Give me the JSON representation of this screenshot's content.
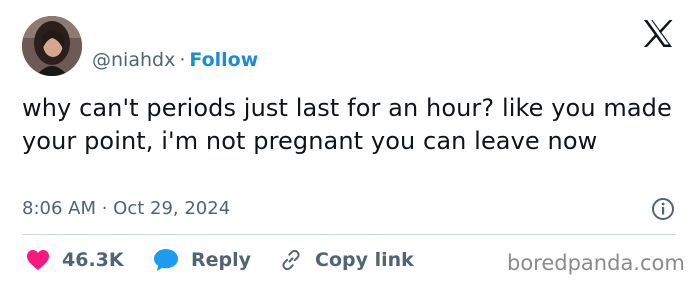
{
  "author": {
    "handle": "@niahdx",
    "separator": "·",
    "follow_label": "Follow"
  },
  "tweet": {
    "text": "why can't periods just last for an hour? like you made your point, i'm not pregnant you can leave now",
    "timestamp": "8:06 AM · Oct 29, 2024"
  },
  "actions": {
    "likes": "46.3K",
    "reply_label": "Reply",
    "copy_label": "Copy link"
  },
  "watermark": "boredpanda.com",
  "icons": {
    "platform": "x-logo-icon",
    "info": "info-icon",
    "like": "heart-icon",
    "reply": "speech-bubble-icon",
    "copy": "link-icon"
  },
  "colors": {
    "follow": "#1d8cd6",
    "like": "#f91880",
    "reply": "#1d9bf0",
    "text": "#0f1419",
    "secondary": "#536471"
  }
}
